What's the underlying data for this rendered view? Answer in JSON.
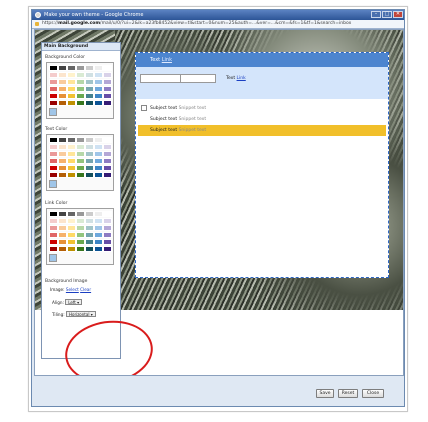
{
  "window": {
    "title": "Make your own theme - Google Chrome",
    "controls": {
      "minimize": "–",
      "maximize": "□",
      "close": "✕"
    }
  },
  "urlbar": {
    "prefix": "https://",
    "domain": "mail.google.com",
    "rest": "/mail/u/0/?ui=2&ik=a23fb8452&view=tl&start=0&num=25&auth=...&ver=...&cm=&fs=1&tf=1&search=inbox"
  },
  "theme_panel": {
    "header": "Main Background",
    "background_color_label": "Background Color",
    "text_color_label": "Text Color",
    "link_color_label": "Link Color",
    "bg_image_label": "Background Image",
    "image_label": "Image:",
    "select_link": "Select",
    "clear_link": "Clear",
    "align_label": "Align:",
    "align_value": "Left",
    "tiling_label": "Tiling:",
    "tiling_value": "Horizontal"
  },
  "preview": {
    "top_text": "Text",
    "top_link": "Link",
    "band_text": "Text",
    "band_link": "Link",
    "rows": [
      {
        "subject": "Subject text",
        "snippet": "Snippet text"
      },
      {
        "subject": "Subject text",
        "snippet": "Snippet text"
      },
      {
        "subject": "Subject text",
        "snippet": "Snippet text"
      }
    ]
  },
  "buttons": {
    "save": "Save",
    "reset": "Reset",
    "close": "Close"
  },
  "colors": {
    "annotation": "#d91c1c",
    "preview_header": "#4d85cf",
    "highlight_row": "#f1bf2a",
    "titlebar": "#2d5597"
  }
}
